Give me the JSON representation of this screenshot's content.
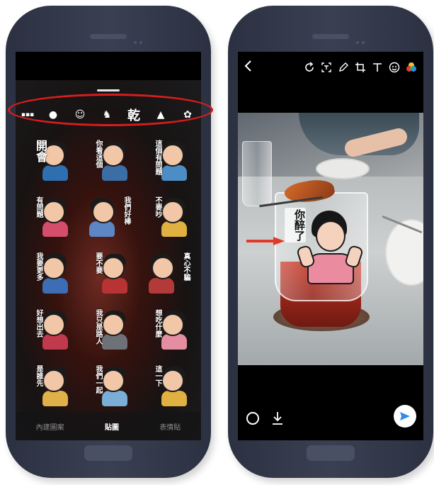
{
  "left_phone": {
    "sticker_strip": {
      "items": [
        {
          "icon": "sticker-pack-text-icon",
          "glyph": "▪▪▪"
        },
        {
          "icon": "sticker-pack-teapot-icon",
          "glyph": "●"
        },
        {
          "icon": "sticker-pack-face-icon",
          "glyph": "☺"
        },
        {
          "icon": "sticker-pack-dinosaur-icon",
          "glyph": "♞"
        },
        {
          "icon": "sticker-pack-calligraphy-icon",
          "glyph": "乾"
        },
        {
          "icon": "sticker-pack-mountain-icon",
          "glyph": "▲"
        },
        {
          "icon": "sticker-pack-rabbit-icon",
          "glyph": "✿"
        }
      ],
      "highlight_color": "#d81d1d"
    },
    "stickers": [
      {
        "caption": "開會",
        "body_color": "#2f6fb0",
        "side": "right",
        "big": true
      },
      {
        "caption": "你看這個",
        "body_color": "#3a6ea5",
        "side": "right",
        "big": false
      },
      {
        "caption": "這個有問題",
        "body_color": "#4d8dc5",
        "side": "right",
        "big": false
      },
      {
        "caption": "有問題",
        "body_color": "#d44d6b",
        "side": "right",
        "big": false
      },
      {
        "caption": "我們好棒",
        "body_color": "#5c86c4",
        "side": "alt",
        "big": false
      },
      {
        "caption": "不要吵",
        "body_color": "#e0b040",
        "side": "right",
        "big": false
      },
      {
        "caption": "我要更多",
        "body_color": "#3c6db5",
        "side": "right",
        "big": false
      },
      {
        "caption": "要不要",
        "body_color": "#b83333",
        "side": "right",
        "big": false
      },
      {
        "caption": "真心不騙",
        "body_color": "#b43a3a",
        "side": "alt",
        "big": false
      },
      {
        "caption": "好想出去",
        "body_color": "#c0394d",
        "side": "right",
        "big": false
      },
      {
        "caption": "我只是路人",
        "body_color": "#6e7277",
        "side": "right",
        "big": false
      },
      {
        "caption": "想吃什麼",
        "body_color": "#e58ea2",
        "side": "right",
        "big": false
      },
      {
        "caption": "是誰先",
        "body_color": "#e0b14a",
        "side": "right",
        "big": false
      },
      {
        "caption": "我們一起",
        "body_color": "#7baed6",
        "side": "right",
        "big": false
      },
      {
        "caption": "這一下",
        "body_color": "#e0b040",
        "side": "right",
        "big": false
      }
    ],
    "tabs": [
      "內建圖案",
      "貼圖",
      "表情貼"
    ],
    "active_tab": "貼圖"
  },
  "right_phone": {
    "toolbar": {
      "back_icon": "back-arrow-icon",
      "tools": [
        "rotate-icon",
        "text-frame-icon",
        "pencil-icon",
        "crop-icon",
        "text-icon",
        "emoji-icon",
        "color-palette-icon"
      ]
    },
    "sticker_text": "你醉了",
    "arrow_color": "#e03a2a",
    "bottom": {
      "timer_icon": "circle-icon",
      "download_icon": "download-icon",
      "send_icon": "send-icon",
      "send_color": "#2f8ce8"
    }
  }
}
